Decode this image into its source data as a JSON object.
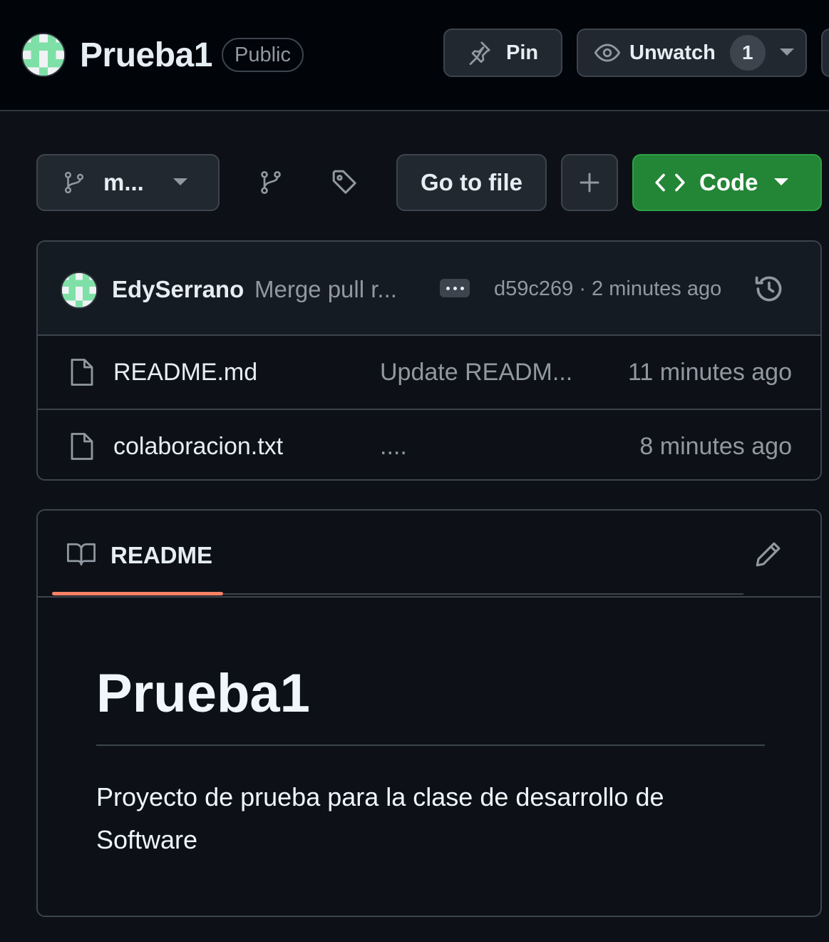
{
  "header": {
    "repo_name": "Prueba1",
    "visibility": "Public",
    "pin_label": "Pin",
    "unwatch_label": "Unwatch",
    "watch_count": "1"
  },
  "toolbar": {
    "branch_label": "m...",
    "go_to_file_label": "Go to file",
    "code_label": "Code"
  },
  "latest_commit": {
    "author": "EdySerrano",
    "message": "Merge pull r...",
    "meta": "d59c269 · 2 minutes ago"
  },
  "files": [
    {
      "name": "README.md",
      "commit_message": "Update READM...",
      "time": "11 minutes ago"
    },
    {
      "name": "colaboracion.txt",
      "commit_message": "....",
      "time": "8 minutes ago"
    }
  ],
  "readme": {
    "tab_label": "README",
    "heading": "Prueba1",
    "paragraph": "Proyecto de prueba para la clase de desarrollo de Software"
  },
  "colors": {
    "background": "#0d1117",
    "header_bg": "#010409",
    "code_button": "#238636",
    "tab_underline": "#f78166",
    "avatar_green": "#7ee0a6"
  },
  "icons": [
    "pin-icon",
    "eye-icon",
    "chevron-down-icon",
    "git-branch-icon",
    "tag-icon",
    "plus-icon",
    "code-icon",
    "kebab-icon",
    "history-icon",
    "file-icon",
    "book-icon",
    "pencil-icon"
  ]
}
